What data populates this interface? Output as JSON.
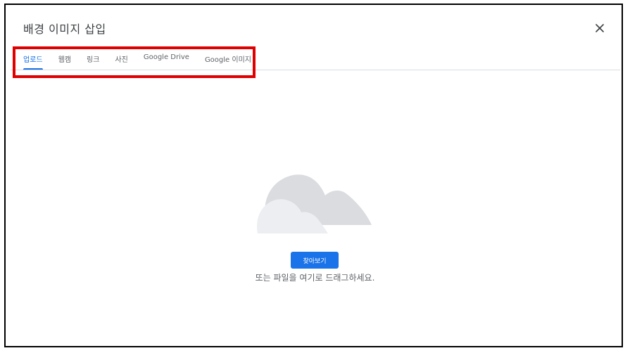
{
  "dialog": {
    "title": "배경 이미지 삽입",
    "close_symbol": "×"
  },
  "tabs": [
    {
      "label": "업로드",
      "active": true
    },
    {
      "label": "웹캠",
      "active": false
    },
    {
      "label": "링크",
      "active": false
    },
    {
      "label": "사진",
      "active": false
    },
    {
      "label": "Google Drive",
      "active": false
    },
    {
      "label": "Google 이미지",
      "active": false
    }
  ],
  "upload": {
    "illustration_icon": "cloud-icon",
    "browse_label": "찾아보기",
    "drop_hint": "또는 파일을 여기로 드래그하세요."
  },
  "colors": {
    "accent": "#1a73e8",
    "highlight": "#e00000",
    "cloud_back": "#dadce0",
    "cloud_front": "#eceef1"
  }
}
